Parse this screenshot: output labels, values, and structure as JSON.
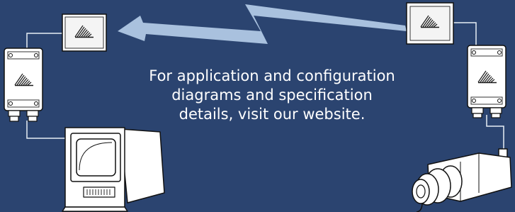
{
  "background_color": "#2b4470",
  "line_color": "#e8eef5",
  "wireless_arrow_color": "#a9c1de",
  "caption": "For application and configuration\ndiagrams and specification\ndetails, visit our website.",
  "devices": [
    {
      "name": "left-wireless-antenna",
      "icon": "wifi-signal-icon"
    },
    {
      "name": "left-receiver-unit",
      "icon": "wifi-signal-icon"
    },
    {
      "name": "crt-monitor"
    },
    {
      "name": "right-wireless-antenna",
      "icon": "wifi-signal-icon"
    },
    {
      "name": "right-transmitter-unit",
      "icon": "wifi-signal-icon"
    },
    {
      "name": "cctv-camera"
    }
  ]
}
